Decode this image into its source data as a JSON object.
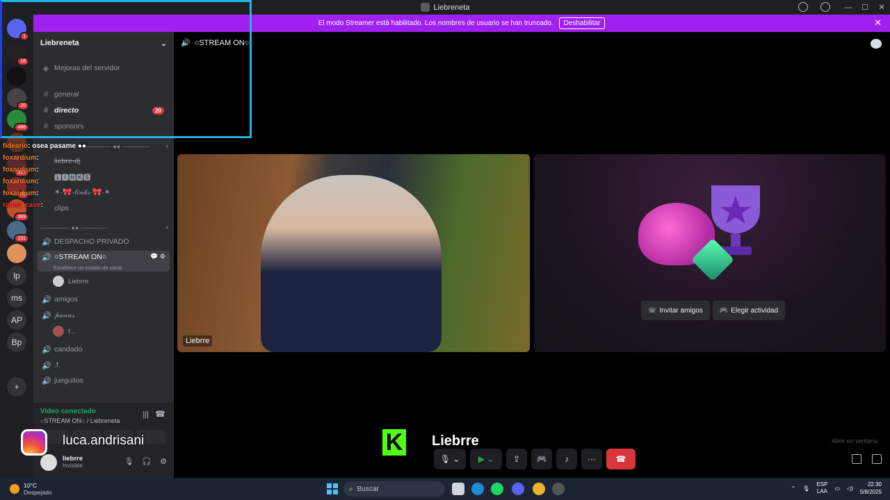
{
  "window": {
    "title": "Liebreneta"
  },
  "banner": {
    "message": "El modo Streamer está habilitado. Los nombres de usuario se han truncado.",
    "button": "Deshabilitar"
  },
  "rail": {
    "servers": [
      {
        "label": "",
        "badge": "1"
      },
      {
        "label": "",
        "badge": "18"
      },
      {
        "label": "",
        "badge": ""
      },
      {
        "label": "",
        "badge": "20"
      },
      {
        "label": "",
        "badge": "486"
      },
      {
        "label": "",
        "badge": ""
      },
      {
        "label": "",
        "badge": "517"
      },
      {
        "label": "",
        "badge": "46"
      },
      {
        "label": "",
        "badge": "369"
      },
      {
        "label": "",
        "badge": "191"
      },
      {
        "label": "",
        "badge": ""
      },
      {
        "label": "lp",
        "badge": ""
      },
      {
        "label": "ms",
        "badge": ""
      },
      {
        "label": "AP",
        "badge": ""
      },
      {
        "label": "Bp",
        "badge": ""
      }
    ]
  },
  "sidebar": {
    "server_name": "Liebreneta",
    "channels_top": [
      {
        "name": "Mejoras del servidor",
        "icon": "boost-icon"
      },
      {
        "name": "general",
        "icon": "#"
      },
      {
        "name": "directo",
        "icon": "#",
        "count": "20"
      },
      {
        "name": "sponsors",
        "icon": "#"
      }
    ],
    "category1": "-------------- ●● -------------",
    "channels_mid": [
      {
        "name": "liebre-dj"
      },
      {
        "name": "🅻🅸🅽🅺🆂"
      },
      {
        "name": "✶·🎀·𝓁𝒾𝓃𝓀𝓈·🎀·✶"
      },
      {
        "name": "clips"
      }
    ],
    "category2": "-------------- ●● -------------",
    "voice": [
      {
        "name": "DESPACHO PRIVADO"
      },
      {
        "name": "○STREAM ON○",
        "status": "Establece un estado de canal"
      },
      {
        "name": "amigos"
      },
      {
        "name": "𝓅𝒶𝓃𝒶𝓈"
      },
      {
        "name": "candado"
      },
      {
        "name": ".f."
      },
      {
        "name": "jueguitos"
      }
    ],
    "members": {
      "stream": "Liebrre",
      "panas": "f..."
    }
  },
  "voicepanel": {
    "title": "Video conectado",
    "subtitle": "○STREAM ON○ / Liebreneta"
  },
  "user": {
    "name": "liebrre",
    "status": "Invisible"
  },
  "stage": {
    "channel": "○STREAM ON○",
    "cam_name": "Liebrre",
    "invite": "Invitar amigos",
    "activity": "Elegir actividad",
    "popout": "Abrir en ventana"
  },
  "overlay": {
    "chat": [
      {
        "user": "fideario",
        "msg": ": osea pasame ●● "
      },
      {
        "user": "foxardium",
        "msg": ":"
      },
      {
        "user": "foxardium",
        "msg": ":"
      },
      {
        "user": "foxardium",
        "msg": ":"
      },
      {
        "user": "foxardium",
        "msg": ":"
      },
      {
        "user": "ramsi_cave",
        "msg": ":"
      }
    ],
    "instagram": "luca.andrisani",
    "kick_letter": "K",
    "kick_name": "Liebrre"
  },
  "taskbar": {
    "weather_temp": "10°C",
    "weather_desc": "Despejado",
    "search": "Buscar",
    "lang1": "ESP",
    "lang2": "LAA",
    "time": "22:30",
    "date": "5/8/2025"
  },
  "colors": {
    "banner": "#a020f0",
    "accent_green": "#23a55a",
    "danger": "#da373c",
    "kick": "#53fc18"
  }
}
